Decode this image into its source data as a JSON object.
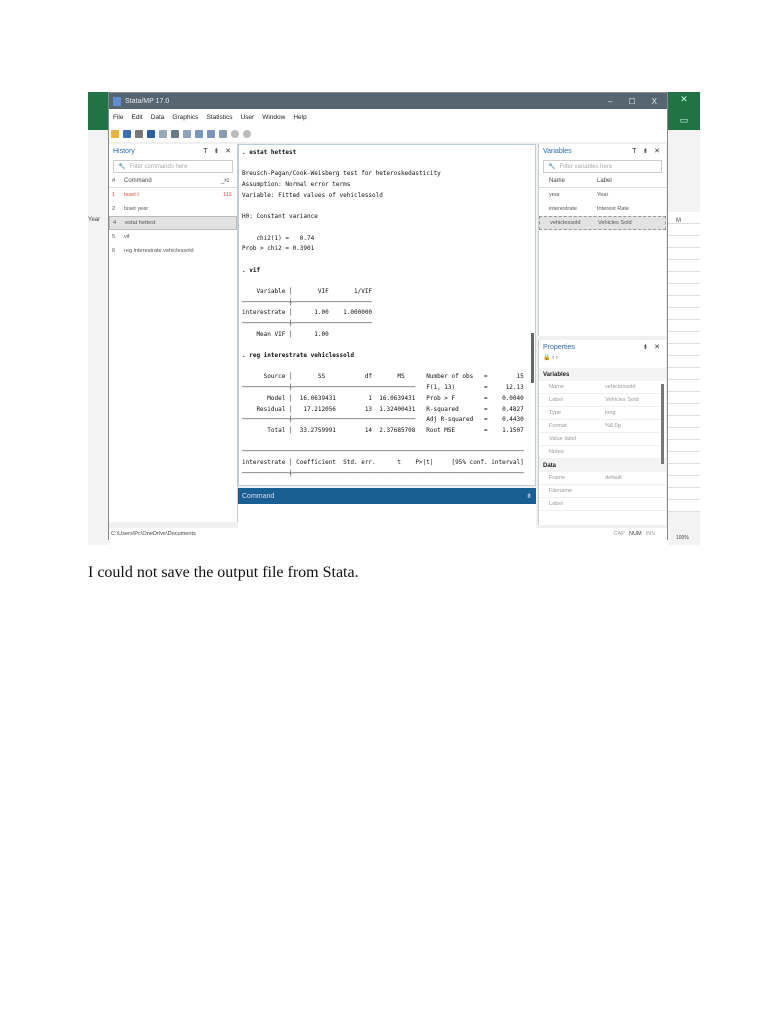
{
  "window": {
    "title": "Stata/MP 17.0",
    "controls": [
      "–",
      "☐",
      "X"
    ]
  },
  "menu": [
    "File",
    "Edit",
    "Data",
    "Graphics",
    "Statistics",
    "User",
    "Window",
    "Help"
  ],
  "history": {
    "title": "History",
    "controls": "T ⇟ ✕",
    "filter_placeholder": "Filter commands here",
    "columns": {
      "num": "#",
      "command": "Command",
      "rc": "_rc"
    },
    "rows": [
      {
        "n": "1",
        "command": "tsset t",
        "rc": "111",
        "error": true
      },
      {
        "n": "2",
        "command": "tsset year",
        "rc": ""
      },
      {
        "n": "4",
        "command": "estat hettest",
        "rc": "",
        "selected": true
      },
      {
        "n": "5",
        "command": "vif",
        "rc": ""
      },
      {
        "n": "6",
        "command": "reg interestrate vehiclessold",
        "rc": ""
      }
    ]
  },
  "results": [
    ". estat hettest",
    "",
    "Breusch-Pagan/Cook-Weisberg test for heteroskedasticity",
    "Assumption: Normal error terms",
    "Variable: Fitted values of vehiclessold",
    "",
    "H0: Constant variance",
    "",
    "    chi2(1) =   0.74",
    "Prob > chi2 = 0.3901",
    "",
    ". vif",
    "",
    "    Variable │       VIF       1/VIF",
    "─────────────┼──────────────────────",
    "interestrate │      1.00    1.000000",
    "─────────────┼──────────────────────",
    "    Mean VIF │      1.00",
    "",
    ". reg interestrate vehiclessold",
    "",
    "      Source │       SS           df       MS      Number of obs   =        15",
    "─────────────┼──────────────────────────────────   F(1, 13)        =     12.13",
    "       Model │  16.0639431         1  16.0639431   Prob > F        =    0.0040",
    "    Residual │   17.212056        13  1.32400431   R-squared       =    0.4827",
    "─────────────┼──────────────────────────────────   Adj R-squared   =    0.4430",
    "       Total │  33.2759991        14  2.37685708   Root MSE        =    1.1507",
    "",
    "──────────────────────────────────────────────────────────────────────────────",
    "interestrate │ Coefficient  Std. err.      t    P>|t|     [95% conf. interval]",
    "─────────────┼────────────────────────────────────────────────────────────────"
  ],
  "command": {
    "title": "Command",
    "pin": "⇟"
  },
  "variables": {
    "title": "Variables",
    "controls": "T ⇟ ✕",
    "filter_placeholder": "Filter variables here",
    "columns": {
      "name": "Name",
      "label": "Label"
    },
    "rows": [
      {
        "name": "year",
        "label": "Year"
      },
      {
        "name": "interestrate",
        "label": "Interest Rate"
      },
      {
        "name": "vehiclessold",
        "label": "Vehicles Sold",
        "selected": true
      }
    ]
  },
  "properties": {
    "title": "Properties",
    "controls": "⇟ ✕",
    "nav": "🔒  ‹  ›",
    "sections": [
      {
        "name": "Variables",
        "rows": [
          [
            "Name",
            "vehiclessold"
          ],
          [
            "Label",
            "Vehicles Sold"
          ],
          [
            "Type",
            "long"
          ],
          [
            "Format",
            "%8.0g"
          ],
          [
            "Value label",
            ""
          ],
          [
            "Notes",
            ""
          ]
        ]
      },
      {
        "name": "Data",
        "rows": [
          [
            "Frame",
            "default"
          ],
          [
            "Filename",
            ""
          ],
          [
            "Label",
            ""
          ]
        ]
      }
    ]
  },
  "status": {
    "path": "C:\\Users\\Pc\\OneDrive\\Documents",
    "indicators": [
      "CAP",
      "NUM",
      "INS"
    ]
  },
  "excel": {
    "zoom": "100%",
    "row_label": "Year",
    "col_label": "M"
  },
  "caption": "I could not save the output file from Stata."
}
